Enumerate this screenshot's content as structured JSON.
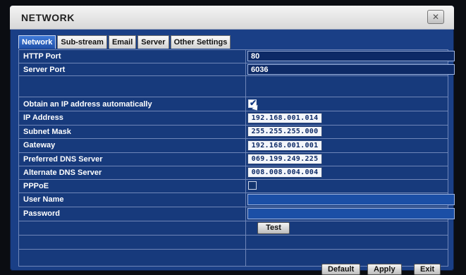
{
  "window": {
    "title": "NETWORK",
    "close_icon": "close-icon"
  },
  "tabs": [
    {
      "label": "Network",
      "active": true
    },
    {
      "label": "Sub-stream",
      "active": false
    },
    {
      "label": "Email",
      "active": false
    },
    {
      "label": "Server",
      "active": false
    },
    {
      "label": "Other Settings",
      "active": false
    }
  ],
  "fields": {
    "http_port": {
      "label": "HTTP Port",
      "value": "80"
    },
    "server_port": {
      "label": "Server Port",
      "value": "6036"
    },
    "obtain_ip": {
      "label": "Obtain an IP address automatically",
      "checked": true
    },
    "ip_address": {
      "label": "IP Address",
      "value": "192.168.001.014"
    },
    "subnet_mask": {
      "label": "Subnet Mask",
      "value": "255.255.255.000"
    },
    "gateway": {
      "label": "Gateway",
      "value": "192.168.001.001"
    },
    "preferred_dns": {
      "label": "Preferred DNS Server",
      "value": "069.199.249.225"
    },
    "alternate_dns": {
      "label": "Alternate DNS Server",
      "value": "008.008.004.004"
    },
    "pppoe": {
      "label": "PPPoE",
      "checked": false
    },
    "user_name": {
      "label": "User Name",
      "value": ""
    },
    "password": {
      "label": "Password",
      "value": ""
    }
  },
  "buttons": {
    "test": "Test",
    "default": "Default",
    "apply": "Apply",
    "exit": "Exit"
  },
  "colors": {
    "panel_bg": "#173a7c",
    "active_tab": "#1f4fa8",
    "titlebar": "#d8d8d8"
  }
}
